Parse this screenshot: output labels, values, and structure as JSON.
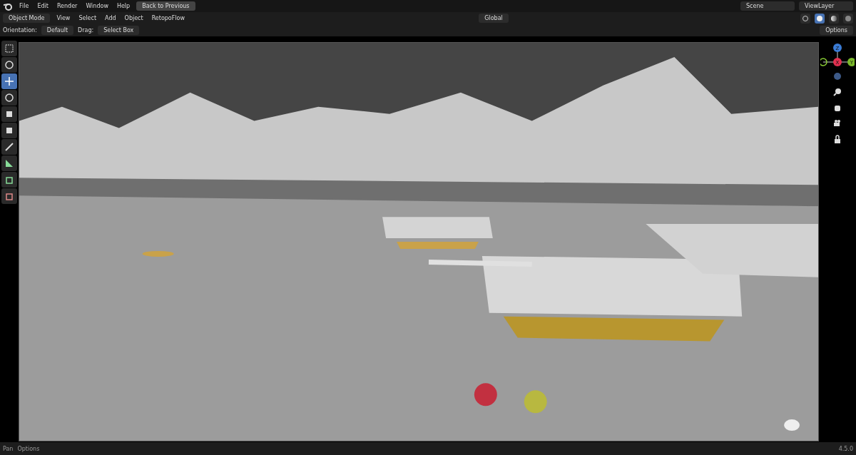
{
  "top_bar": {
    "menus": [
      "File",
      "Edit",
      "Render",
      "Window",
      "Help"
    ],
    "back_button": "Back to Previous",
    "scene": "Scene",
    "view_layer": "ViewLayer"
  },
  "header": {
    "mode": "Object Mode",
    "menus": [
      "View",
      "Select",
      "Add",
      "Object",
      "RetopoFlow"
    ],
    "orientation": "Global",
    "shading": [
      {
        "kind": "wire",
        "selected": false
      },
      {
        "kind": "solid",
        "selected": true
      },
      {
        "kind": "material",
        "selected": false
      },
      {
        "kind": "render",
        "selected": false
      }
    ]
  },
  "tool_settings": {
    "orientation_label": "Orientation:",
    "orientation": "Default",
    "drag_label": "Drag:",
    "drag": "Select Box",
    "options": "Options"
  },
  "toolbar": [
    {
      "kind": "select",
      "selected": false
    },
    {
      "kind": "cursor",
      "selected": false
    },
    {
      "kind": "move",
      "selected": true
    },
    {
      "kind": "rotate",
      "selected": false
    },
    {
      "kind": "scale",
      "selected": false
    },
    {
      "kind": "transform",
      "selected": false
    },
    {
      "kind": "annotate",
      "selected": false
    },
    {
      "kind": "measure",
      "selected": false
    },
    {
      "kind": "add",
      "selected": false
    },
    {
      "kind": "cut",
      "selected": false
    }
  ],
  "gizmo": {
    "z": "Z",
    "x": "X",
    "y": "Y"
  },
  "status_bar": {
    "items": [
      "Pan",
      "Options"
    ],
    "version": "4.5.0"
  }
}
